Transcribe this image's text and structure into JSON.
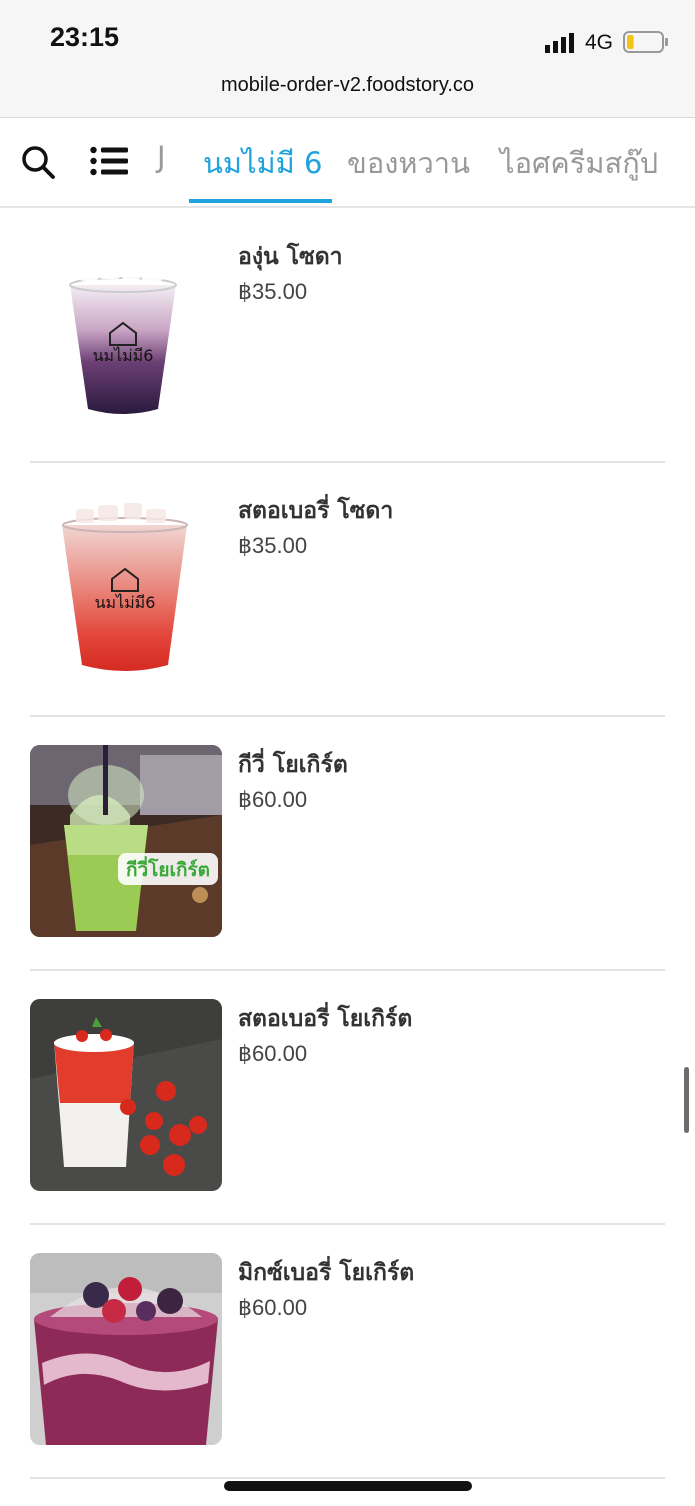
{
  "status_bar": {
    "time": "23:15",
    "network": "4G",
    "battery_level_fraction": 0.2,
    "battery_color": "#f3c316"
  },
  "browser": {
    "url": "mobile-order-v2.foodstory.co"
  },
  "category_bar": {
    "search_icon": "search-icon",
    "list_icon": "list-icon",
    "accent_color": "#1fa2dd",
    "tabs": [
      {
        "label": "J",
        "active": false
      },
      {
        "label": "นมไม่มี 6",
        "active": true
      },
      {
        "label": "ของหวาน",
        "active": false
      },
      {
        "label": "ไอศครีมสกู๊ป",
        "active": false
      }
    ]
  },
  "menu": {
    "items": [
      {
        "name": "องุ่น โซดา",
        "price": "฿35.00",
        "image": "grape-soda-cup"
      },
      {
        "name": "สตอเบอรี่ โซดา",
        "price": "฿35.00",
        "image": "strawberry-soda-cup"
      },
      {
        "name": "กีวี่ โยเกิร์ต",
        "price": "฿60.00",
        "image": "kiwi-yogurt-photo"
      },
      {
        "name": "สตอเบอรี่ โยเกิร์ต",
        "price": "฿60.00",
        "image": "strawberry-yogurt-photo"
      },
      {
        "name": "มิกซ์เบอรี่ โยเกิร์ต",
        "price": "฿60.00",
        "image": "mixberry-yogurt-photo"
      }
    ]
  },
  "image_texts": {
    "cup_logo": "นมไม่มี6",
    "kiwi_overlay": "กีวี่โยเกิร์ต"
  }
}
